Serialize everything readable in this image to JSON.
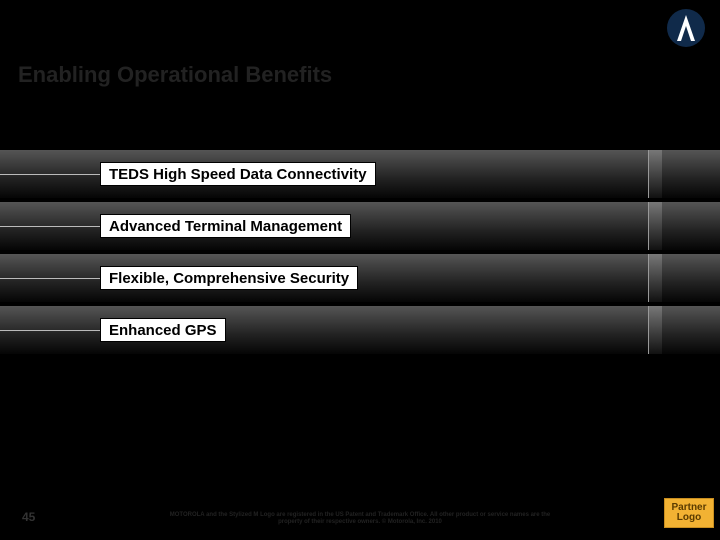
{
  "header": {
    "title": "Enabling Operational Benefits",
    "logo_name": "motorola-batwing-logo"
  },
  "bars": [
    {
      "label": "TEDS High Speed Data Connectivity"
    },
    {
      "label": "Advanced Terminal Management"
    },
    {
      "label": "Flexible, Comprehensive Security"
    },
    {
      "label": "Enhanced GPS"
    }
  ],
  "footer": {
    "page_number": "45",
    "legal_text": "MOTOROLA and the Stylized M Logo are registered in the US Patent and Trademark Office. All other product or service names are the property of their respective owners. © Motorola, Inc. 2010",
    "partner_logo_text": "Partner Logo"
  }
}
